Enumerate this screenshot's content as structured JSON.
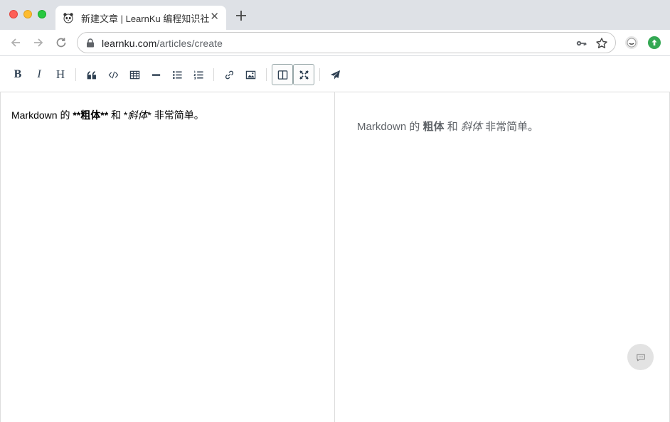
{
  "browser": {
    "tab_title": "新建文章 | LearnKu 编程知识社区",
    "tab_close": "✕",
    "url_host": "learnku.com",
    "url_path": "/articles/create"
  },
  "editor_toolbar": {
    "bold_label": "B",
    "italic_label": "I",
    "heading_label": "H"
  },
  "editor": {
    "seg1": "Markdown 的 ",
    "seg2": "**粗体**",
    "seg3": " 和 *",
    "seg4": "斜体",
    "seg5": "* 非常简单。"
  },
  "preview": {
    "seg1": "Markdown 的 ",
    "seg2": "粗体",
    "seg3": " 和 ",
    "seg4": "斜体",
    "seg5": " 非常简单。"
  },
  "icons": {
    "favicon": "panda-icon",
    "lock": "lock-icon",
    "key": "key-icon",
    "star": "star-icon",
    "chat": "chat-bubble-icon"
  },
  "colors": {
    "tabstrip_bg": "#dee1e6",
    "toolbar_text": "#2c3e50",
    "preview_text": "#5f6368",
    "extension_green": "#34a853"
  }
}
